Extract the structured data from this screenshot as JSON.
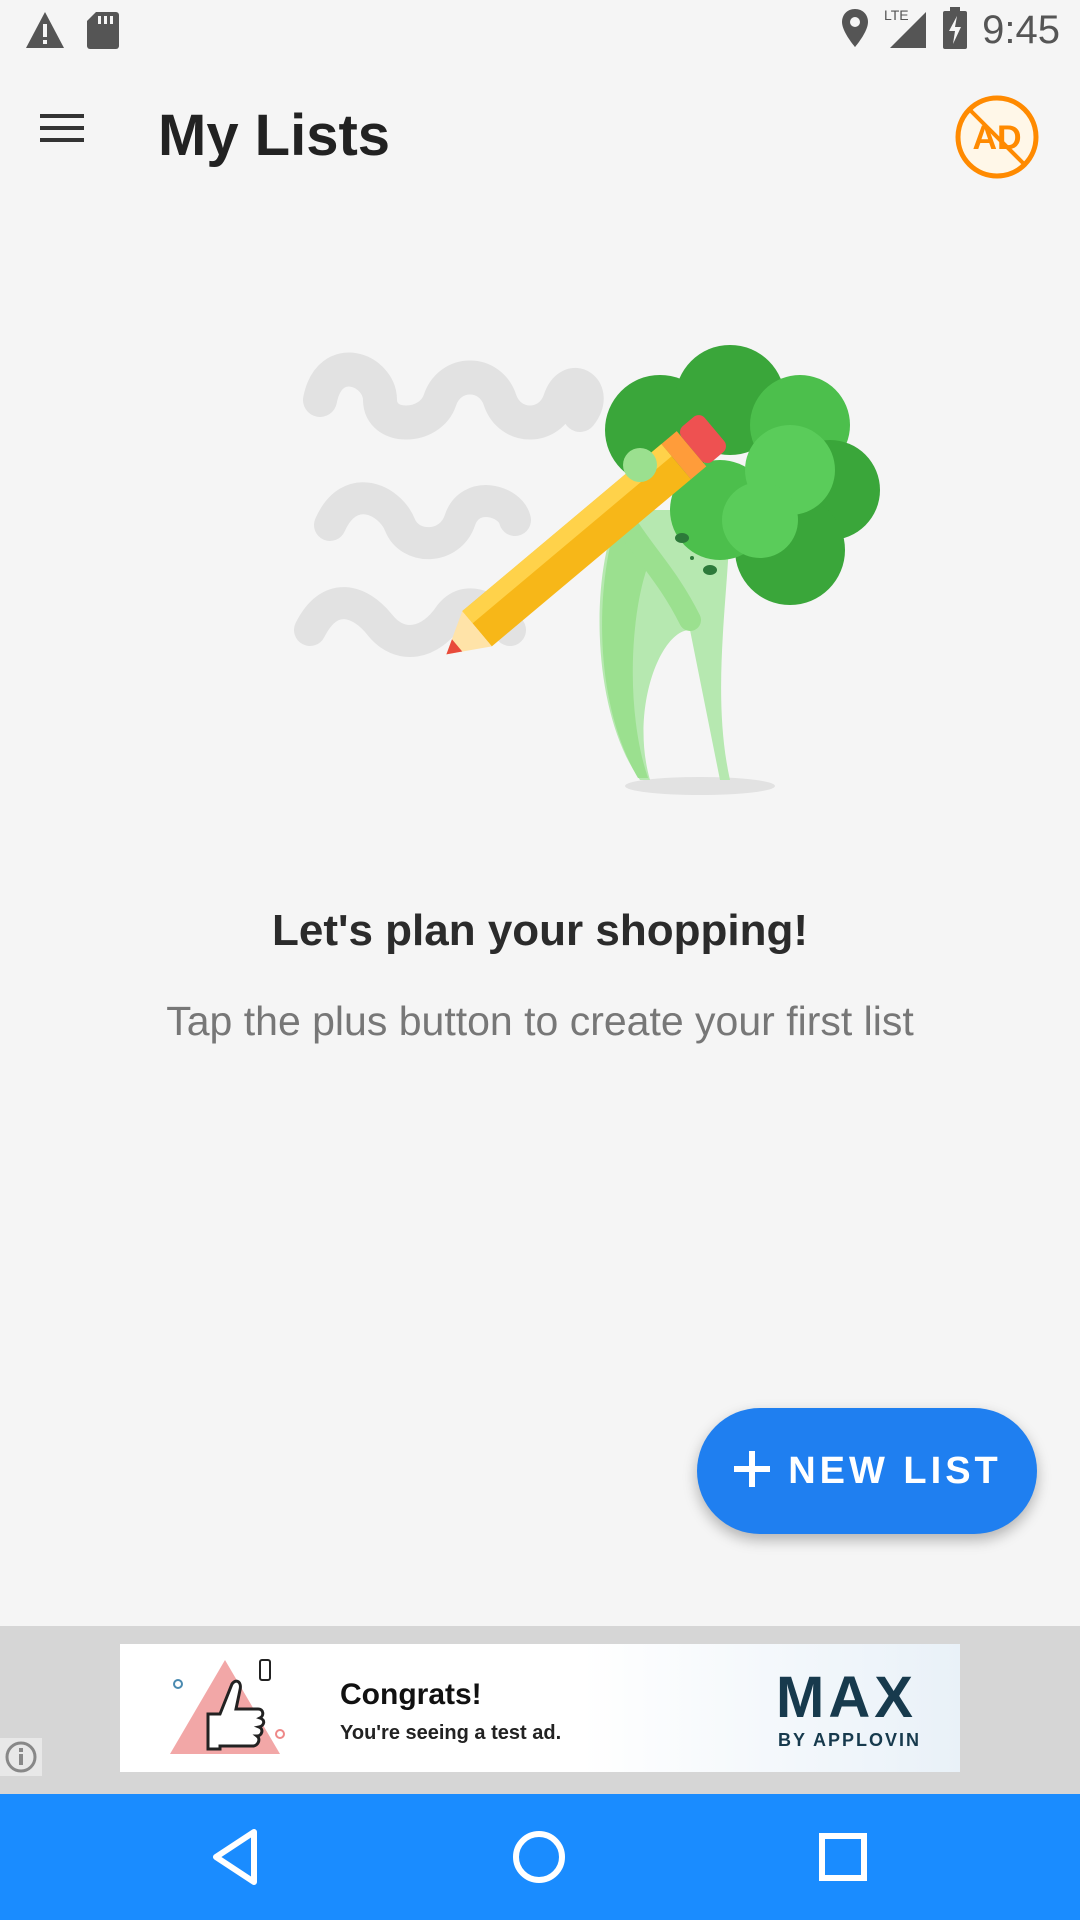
{
  "status_bar": {
    "time": "9:45",
    "network": "LTE",
    "icons": [
      "warning-icon",
      "sd-card-icon",
      "location-icon",
      "signal-icon",
      "battery-charging-icon"
    ]
  },
  "app_bar": {
    "title": "My Lists",
    "menu_icon": "hamburger-menu-icon",
    "ad_button_label": "AD",
    "ad_button_color": "#ff8a00"
  },
  "empty_state": {
    "title": "Let's plan your shopping!",
    "subtitle": "Tap the plus button to create your first list"
  },
  "fab": {
    "icon": "plus-icon",
    "label": "NEW LIST",
    "color": "#1f7ff0"
  },
  "ad_banner": {
    "headline": "Congrats!",
    "text": "You're seeing a test ad.",
    "brand": "MAX",
    "brand_sub": "BY APPLOVIN",
    "info_icon": "info-icon"
  },
  "nav_bar": {
    "color": "#1a8cff",
    "buttons": [
      "back-icon",
      "home-icon",
      "recents-icon"
    ]
  }
}
